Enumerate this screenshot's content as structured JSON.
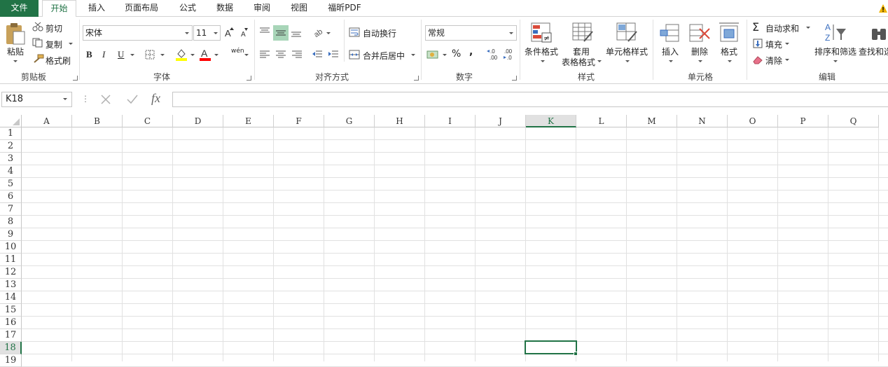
{
  "tabs": [
    "文件",
    "开始",
    "插入",
    "页面布局",
    "公式",
    "数据",
    "审阅",
    "视图",
    "福昕PDF"
  ],
  "clipboard": {
    "paste": "粘贴",
    "cut": "剪切",
    "copy": "复制",
    "format_painter": "格式刷",
    "group": "剪贴板"
  },
  "font": {
    "name": "宋体",
    "size": "11",
    "group": "字体",
    "bold": "B",
    "italic": "I",
    "underline": "U",
    "font_color": "A",
    "phonetic": "wén"
  },
  "alignment": {
    "wrap_text": "自动换行",
    "merge_center": "合并后居中",
    "group": "对齐方式"
  },
  "number": {
    "format": "常规",
    "percent": "%",
    "comma": ",",
    "group": "数字",
    "inc_decimal": "←.0\n.00",
    "dec_decimal": ".00\n→.0"
  },
  "styles": {
    "conditional": "条件格式",
    "table_format_1": "套用",
    "table_format_2": "表格格式",
    "cell_styles": "单元格样式",
    "group": "样式"
  },
  "cells": {
    "insert": "插入",
    "delete": "删除",
    "format": "格式",
    "group": "单元格"
  },
  "editing": {
    "autosum": "自动求和",
    "fill": "填充",
    "clear": "清除",
    "sort_filter": "排序和筛选",
    "find_select": "查找和选",
    "group": "编辑"
  },
  "formula_bar": {
    "name_box": "K18",
    "fx": "fx",
    "formula": ""
  },
  "columns": [
    "A",
    "B",
    "C",
    "D",
    "E",
    "F",
    "G",
    "H",
    "I",
    "J",
    "K",
    "L",
    "M",
    "N",
    "O",
    "P",
    "Q"
  ],
  "rows": [
    "1",
    "2",
    "3",
    "4",
    "5",
    "6",
    "7",
    "8",
    "9",
    "10",
    "11",
    "12",
    "13",
    "14",
    "15",
    "16",
    "17",
    "18",
    "19"
  ],
  "colors": {
    "accent": "#217346",
    "highlight": "#ffff00",
    "font_red": "#ff0000"
  }
}
